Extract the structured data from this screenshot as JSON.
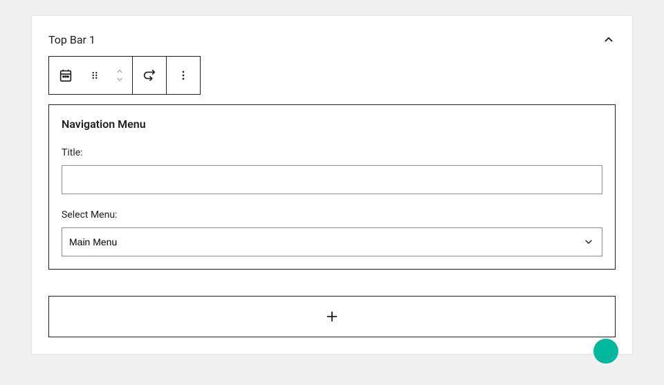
{
  "panel": {
    "title": "Top Bar 1"
  },
  "widget": {
    "title": "Navigation Menu",
    "titleField": {
      "label": "Title:",
      "value": ""
    },
    "selectMenu": {
      "label": "Select Menu:",
      "selected": "Main Menu"
    }
  }
}
